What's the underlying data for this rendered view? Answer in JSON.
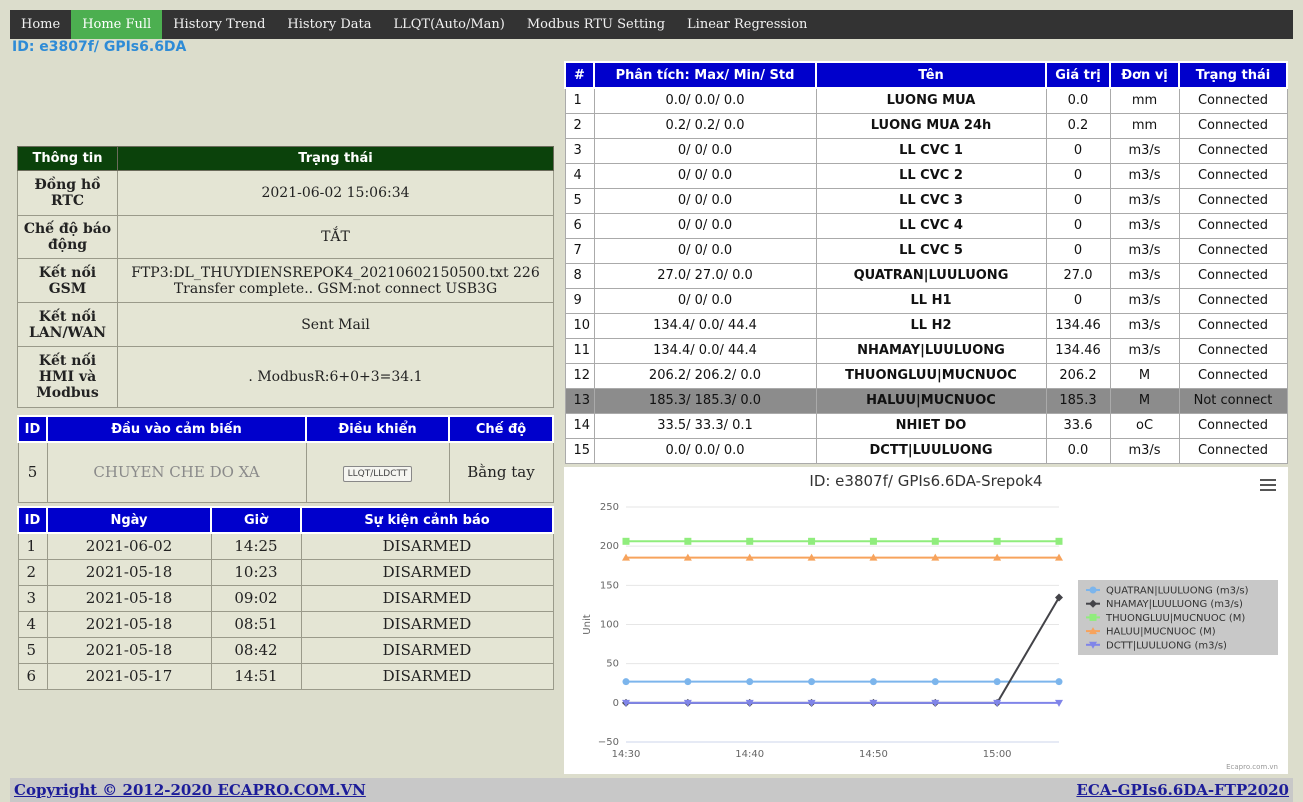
{
  "nav": [
    {
      "label": "Home"
    },
    {
      "label": "Home Full",
      "active": true
    },
    {
      "label": "History Trend"
    },
    {
      "label": "History Data"
    },
    {
      "label": "LLQT(Auto/Man)"
    },
    {
      "label": "Modbus RTU Setting"
    },
    {
      "label": "Linear Regression"
    }
  ],
  "device_id": "ID: e3807f/ GPIs6.6DA",
  "info": {
    "header": [
      "Thông tin",
      "Trạng thái"
    ],
    "rows": [
      {
        "label": "Đồng hồ RTC",
        "value": "2021-06-02 15:06:34"
      },
      {
        "label": "Chế độ báo động",
        "value": "TẮT"
      },
      {
        "label": "Kết nối GSM",
        "value": "FTP3:DL_THUYDIENSREPOK4_20210602150500.txt 226 Transfer complete.. GSM:not connect USB3G"
      },
      {
        "label": "Kết nối LAN/WAN",
        "value": "Sent Mail"
      },
      {
        "label": "Kết nối HMI và Modbus",
        "value": ". ModbusR:6+0+3=34.1"
      }
    ]
  },
  "sensor": {
    "header": [
      "ID",
      "Đầu vào cảm biến",
      "Điều khiển",
      "Chế độ"
    ],
    "row": {
      "id": "5",
      "input": "CHUYEN CHE DO XA",
      "button": "LLQT/LLDCTT",
      "mode": "Bằng tay"
    }
  },
  "alarms": {
    "header": [
      "ID",
      "Ngày",
      "Giờ",
      "Sự kiện cảnh báo"
    ],
    "rows": [
      {
        "id": "1",
        "date": "2021-06-02",
        "time": "14:25",
        "event": "DISARMED"
      },
      {
        "id": "2",
        "date": "2021-05-18",
        "time": "10:23",
        "event": "DISARMED"
      },
      {
        "id": "3",
        "date": "2021-05-18",
        "time": "09:02",
        "event": "DISARMED"
      },
      {
        "id": "4",
        "date": "2021-05-18",
        "time": "08:51",
        "event": "DISARMED"
      },
      {
        "id": "5",
        "date": "2021-05-18",
        "time": "08:42",
        "event": "DISARMED"
      },
      {
        "id": "6",
        "date": "2021-05-17",
        "time": "14:51",
        "event": "DISARMED"
      }
    ]
  },
  "data_table": {
    "header": [
      "#",
      "Phân tích: Max/ Min/ Std",
      "Tên",
      "Giá trị",
      "Đơn vị",
      "Trạng thái"
    ],
    "rows": [
      {
        "no": "1",
        "stats": "0.0/ 0.0/ 0.0",
        "name": "LUONG MUA",
        "value": "0.0",
        "unit": "mm",
        "status": "Connected"
      },
      {
        "no": "2",
        "stats": "0.2/ 0.2/ 0.0",
        "name": "LUONG MUA 24h",
        "value": "0.2",
        "unit": "mm",
        "status": "Connected"
      },
      {
        "no": "3",
        "stats": "0/ 0/ 0.0",
        "name": "LL CVC 1",
        "value": "0",
        "unit": "m3/s",
        "status": "Connected"
      },
      {
        "no": "4",
        "stats": "0/ 0/ 0.0",
        "name": "LL CVC 2",
        "value": "0",
        "unit": "m3/s",
        "status": "Connected"
      },
      {
        "no": "5",
        "stats": "0/ 0/ 0.0",
        "name": "LL CVC 3",
        "value": "0",
        "unit": "m3/s",
        "status": "Connected"
      },
      {
        "no": "6",
        "stats": "0/ 0/ 0.0",
        "name": "LL CVC 4",
        "value": "0",
        "unit": "m3/s",
        "status": "Connected"
      },
      {
        "no": "7",
        "stats": "0/ 0/ 0.0",
        "name": "LL CVC 5",
        "value": "0",
        "unit": "m3/s",
        "status": "Connected"
      },
      {
        "no": "8",
        "stats": "27.0/ 27.0/ 0.0",
        "name": "QUATRAN|LUULUONG",
        "value": "27.0",
        "unit": "m3/s",
        "status": "Connected"
      },
      {
        "no": "9",
        "stats": "0/ 0/ 0.0",
        "name": "LL H1",
        "value": "0",
        "unit": "m3/s",
        "status": "Connected"
      },
      {
        "no": "10",
        "stats": "134.4/ 0.0/ 44.4",
        "name": "LL H2",
        "value": "134.46",
        "unit": "m3/s",
        "status": "Connected"
      },
      {
        "no": "11",
        "stats": "134.4/ 0.0/ 44.4",
        "name": "NHAMAY|LUULUONG",
        "value": "134.46",
        "unit": "m3/s",
        "status": "Connected"
      },
      {
        "no": "12",
        "stats": "206.2/ 206.2/ 0.0",
        "name": "THUONGLUU|MUCNUOC",
        "value": "206.2",
        "unit": "M",
        "status": "Connected"
      },
      {
        "no": "13",
        "stats": "185.3/ 185.3/ 0.0",
        "name": "HALUU|MUCNUOC",
        "value": "185.3",
        "unit": "M",
        "status": "Not connect",
        "alert": true
      },
      {
        "no": "14",
        "stats": "33.5/ 33.3/ 0.1",
        "name": "NHIET DO",
        "value": "33.6",
        "unit": "oC",
        "status": "Connected"
      },
      {
        "no": "15",
        "stats": "0.0/ 0.0/ 0.0",
        "name": "DCTT|LUULUONG",
        "value": "0.0",
        "unit": "m3/s",
        "status": "Connected"
      }
    ]
  },
  "chart_data": {
    "type": "line",
    "title": "ID: e3807f/ GPIs6.6DA-Srepok4",
    "ylabel": "Unit",
    "xlabel": "",
    "x": [
      "14:30",
      "14:35",
      "14:40",
      "14:45",
      "14:50",
      "14:55",
      "15:00",
      "15:05"
    ],
    "x_ticks": [
      "14:30",
      "14:40",
      "14:50",
      "15:00"
    ],
    "ylim": [
      -50,
      250
    ],
    "y_ticks": [
      -50,
      0,
      50,
      100,
      150,
      200,
      250
    ],
    "grid": true,
    "legend_position": "right",
    "series": [
      {
        "name": "QUATRAN|LUULUONG (m3/s)",
        "color": "#7cb5ec",
        "marker": "circle",
        "values": [
          27,
          27,
          27,
          27,
          27,
          27,
          27,
          27
        ]
      },
      {
        "name": "NHAMAY|LUULUONG (m3/s)",
        "color": "#434348",
        "marker": "diamond",
        "values": [
          0,
          0,
          0,
          0,
          0,
          0,
          0,
          134.46
        ]
      },
      {
        "name": "THUONGLUU|MUCNUOC (M)",
        "color": "#90ed7d",
        "marker": "square",
        "values": [
          206.2,
          206.2,
          206.2,
          206.2,
          206.2,
          206.2,
          206.2,
          206.2
        ]
      },
      {
        "name": "HALUU|MUCNUOC (M)",
        "color": "#f7a35c",
        "marker": "triangle",
        "values": [
          185.3,
          185.3,
          185.3,
          185.3,
          185.3,
          185.3,
          185.3,
          185.3
        ]
      },
      {
        "name": "DCTT|LUULUONG (m3/s)",
        "color": "#8085e9",
        "marker": "triangle-down",
        "values": [
          0,
          0,
          0,
          0,
          0,
          0,
          0,
          0
        ]
      }
    ],
    "credit": "Ecapro.com.vn"
  },
  "footer": {
    "left": "Copyright © 2012-2020 ECAPRO.COM.VN",
    "right": "ECA-GPIs6.6DA-FTP2020"
  }
}
